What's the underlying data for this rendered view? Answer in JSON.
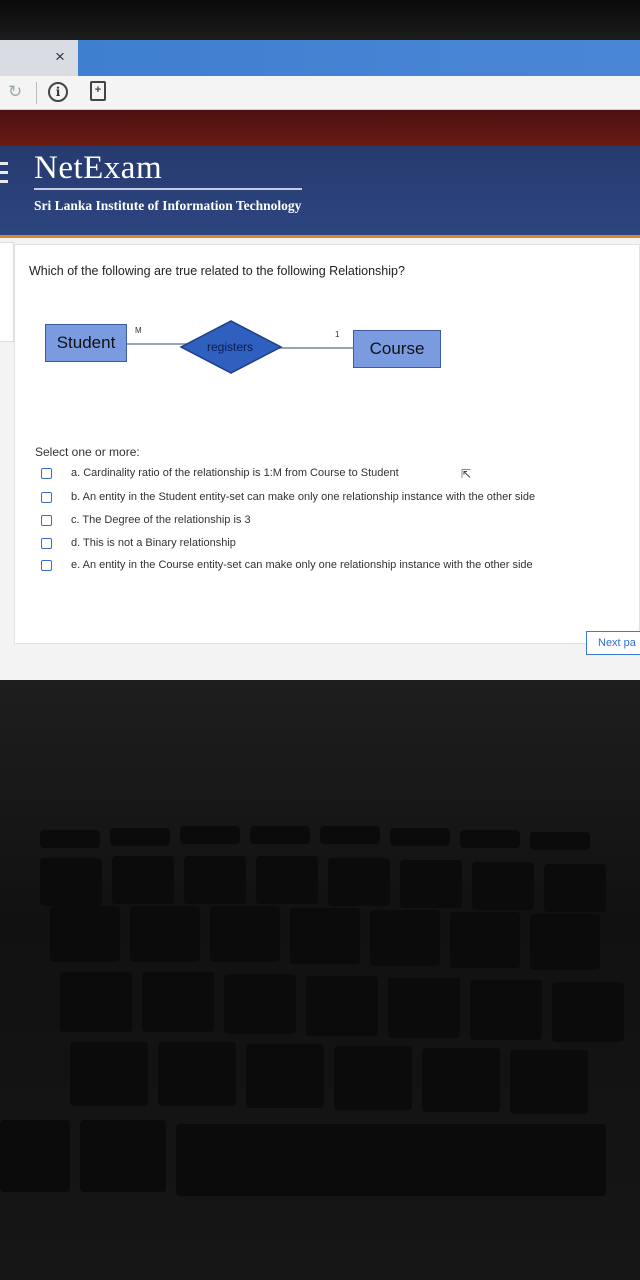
{
  "browser": {
    "tab_close": "×",
    "info_icon": "i",
    "page_icon": "+"
  },
  "header": {
    "title": "NetExam",
    "subtitle": "Sri Lanka Institute of Information Technology"
  },
  "question": {
    "text": "Which of the following are true related to the following Relationship?",
    "diagram": {
      "entity_left": "Student",
      "relationship": "registers",
      "entity_right": "Course",
      "cardinality_left": "M",
      "cardinality_right": "1"
    },
    "select_label": "Select one or more:",
    "options": [
      "a. Cardinality ratio of the relationship is 1:M from Course to Student",
      "b. An entity in the Student entity-set can make only one relationship instance with the other side",
      "c. The Degree of the relationship is 3",
      "d. This is not a Binary relationship",
      "e. An entity in the Course entity-set can make only one relationship instance with the other side"
    ]
  },
  "navigation": {
    "next_label": "Next pa"
  },
  "colors": {
    "header_bg": "#2d4580",
    "header_accent": "#d28a2c",
    "entity_fill": "#7b9be0",
    "relationship_fill": "#2f5fbf",
    "link_blue": "#2d6fd0"
  }
}
